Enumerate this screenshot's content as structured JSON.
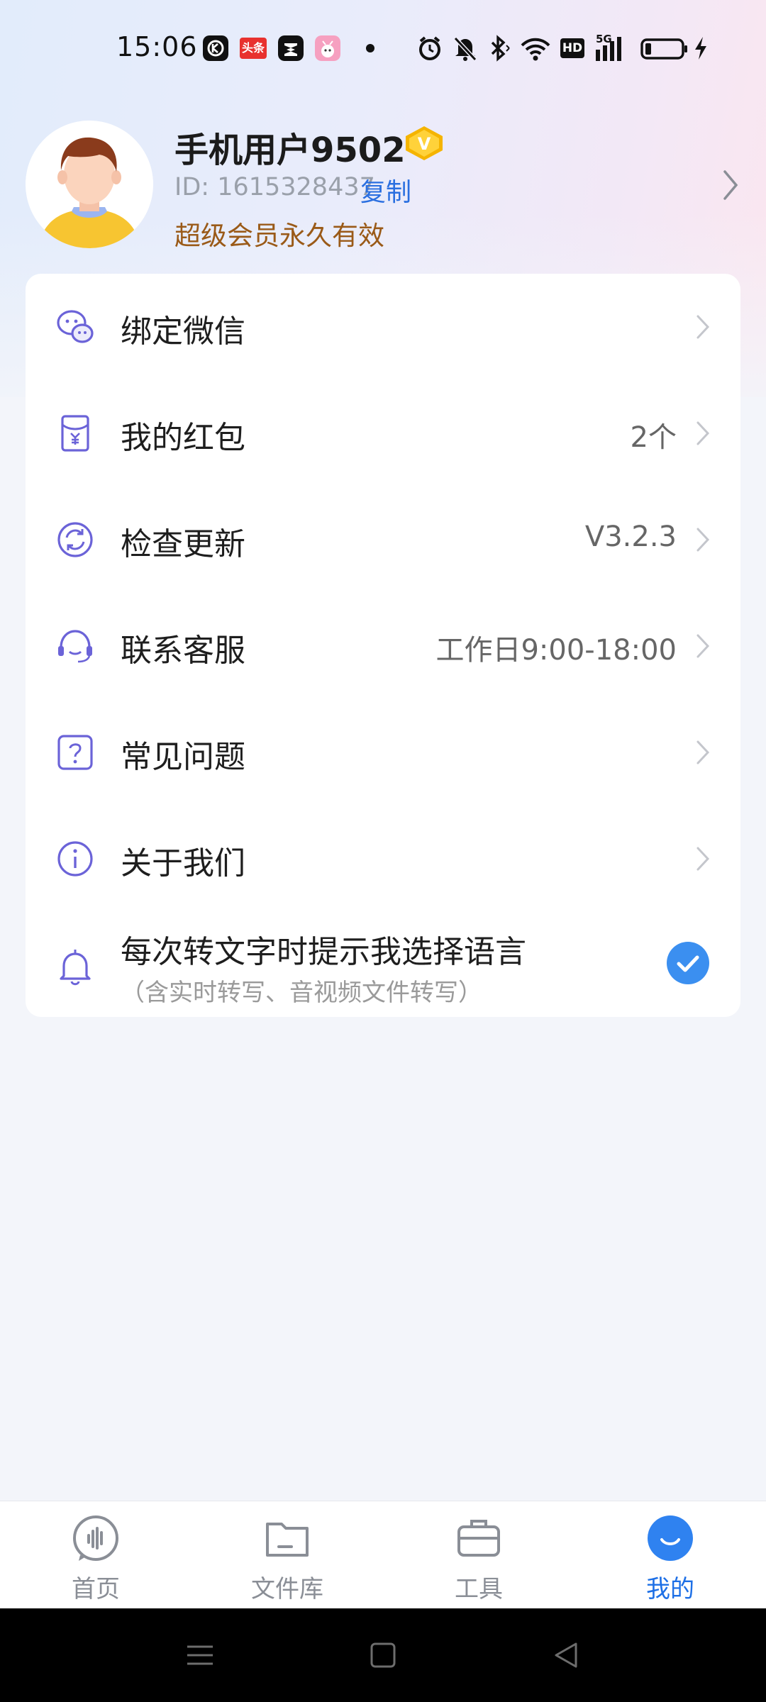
{
  "status_bar": {
    "time": "15:06",
    "icons": [
      "kwai-app-icon",
      "toutiao-app-icon",
      "capcut-app-icon",
      "bilibili-app-icon",
      "notification-dot-icon",
      "alarm-icon",
      "mute-icon",
      "bluetooth-icon",
      "wifi-icon",
      "hd-icon",
      "signal-5g-icon",
      "battery-icon",
      "charging-icon"
    ],
    "toutiao_text": "头条",
    "hd_text": "HD",
    "fiveg_text": "5G"
  },
  "profile": {
    "username": "手机用户9502",
    "vip_badge_letter": "V",
    "user_id": "ID: 1615328437",
    "copy_label": "复制",
    "vip_status": "超级会员永久有效"
  },
  "menu": {
    "items": [
      {
        "label": "绑定微信",
        "value": "",
        "icon": "wechat-icon"
      },
      {
        "label": "我的红包",
        "value": "2个",
        "icon": "red-envelope-icon"
      },
      {
        "label": "检查更新",
        "value": "V3.2.3",
        "icon": "refresh-icon"
      },
      {
        "label": "联系客服",
        "value": "工作日9:00-18:00",
        "icon": "headset-icon"
      },
      {
        "label": "常见问题",
        "value": "",
        "icon": "question-icon"
      },
      {
        "label": "关于我们",
        "value": "",
        "icon": "info-icon"
      }
    ],
    "language_prompt": {
      "label": "每次转文字时提示我选择语言",
      "sublabel": "（含实时转写、音视频文件转写）",
      "checked": true
    }
  },
  "tabs": [
    {
      "label": "首页",
      "icon": "voice-icon",
      "active": false
    },
    {
      "label": "文件库",
      "icon": "folder-icon",
      "active": false
    },
    {
      "label": "工具",
      "icon": "toolbox-icon",
      "active": false
    },
    {
      "label": "我的",
      "icon": "profile-smile-icon",
      "active": true
    }
  ],
  "colors": {
    "accent": "#1d6fe6",
    "icon_purple": "#6b63d8",
    "vip_gold": "#f5b400",
    "vip_text": "#9a5a18"
  }
}
